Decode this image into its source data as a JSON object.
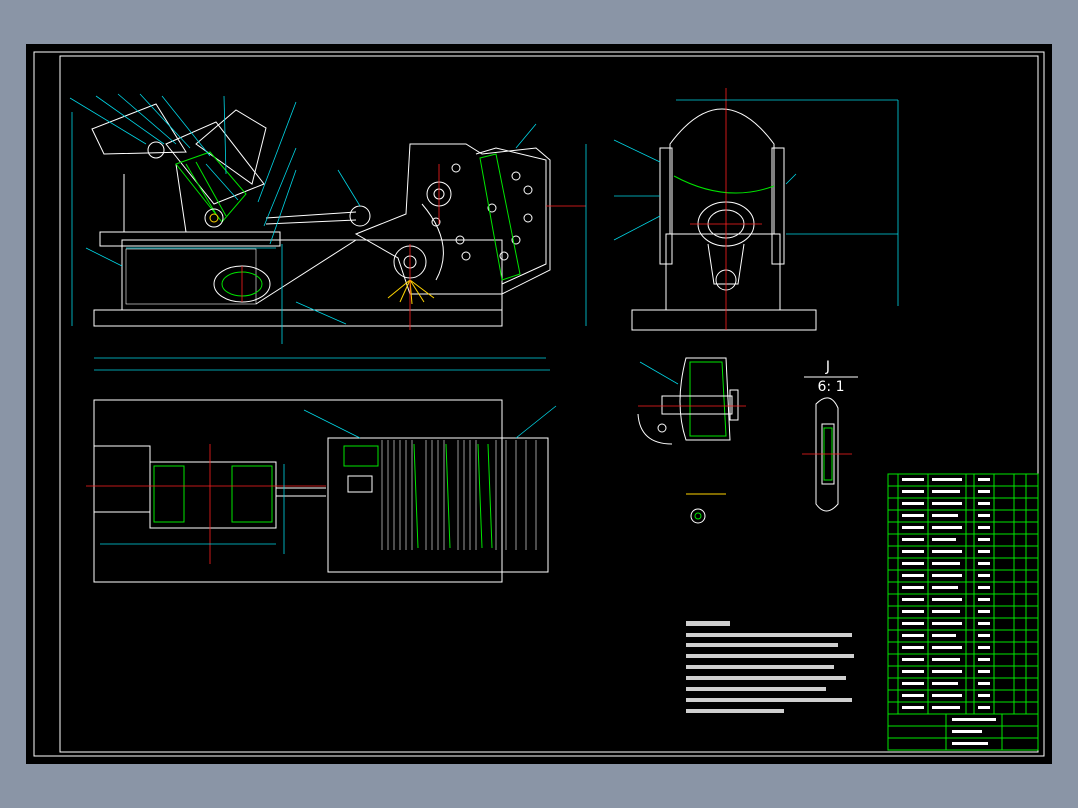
{
  "drawing": {
    "detail_callout": {
      "letter": "J",
      "scale": "6: 1"
    },
    "colors": {
      "frame_background": "#8a95a6",
      "drawing_background": "#000000",
      "outline": "#ffffff",
      "dimension": "#00d6e6",
      "hatch": "#00e600",
      "centerline": "#ff2020",
      "highlight": "#ffd400"
    }
  },
  "icons": [
    "cad-viewport",
    "title-block-grid"
  ]
}
